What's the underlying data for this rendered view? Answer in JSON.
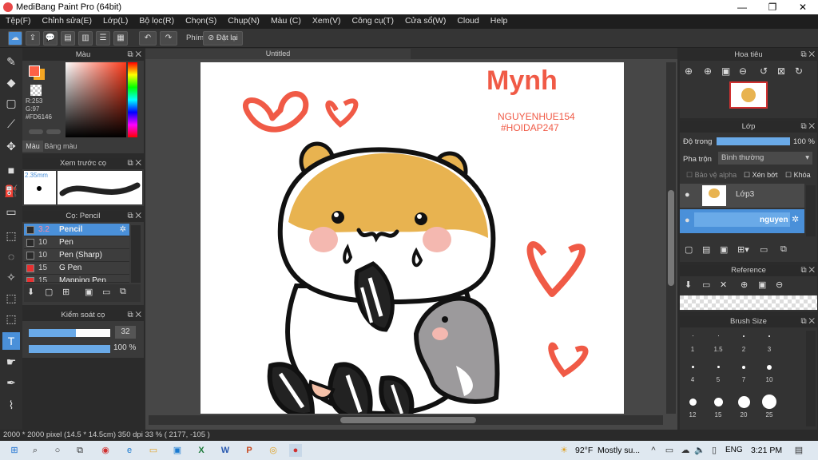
{
  "window": {
    "title": "MediBang Paint Pro (64bit)"
  },
  "menu": [
    "Tệp(F)",
    "Chỉnh sửa(E)",
    "Lớp(L)",
    "Bộ lọc(R)",
    "Chọn(S)",
    "Chụp(N)",
    "Màu (C)",
    "Xem(V)",
    "Công cụ(T)",
    "Cửa sổ(W)",
    "Cloud",
    "Help"
  ],
  "toolbar": {
    "shortcut_label": "Phím",
    "undo_label": "Đặt lại"
  },
  "color_panel": {
    "title": "Màu",
    "r": "R:253",
    "g": "G:97",
    "hex": "#FD6146",
    "tab_color": "Màu",
    "tab_palette": "Bảng màu",
    "primary": "#fd6146",
    "secondary": "#f5a623"
  },
  "brush_preview": {
    "title": "Xem trước cọ",
    "size": "2.35mm"
  },
  "brush_panel": {
    "title": "Cọ: Pencil",
    "items": [
      {
        "size": "3.2",
        "name": "Pencil",
        "color": "#2a2a2a"
      },
      {
        "size": "10",
        "name": "Pen",
        "color": "#2a2a2a"
      },
      {
        "size": "10",
        "name": "Pen (Sharp)",
        "color": "#2a2a2a"
      },
      {
        "size": "15",
        "name": "G Pen",
        "color": "#e83030"
      },
      {
        "size": "15",
        "name": "Mapping Pen",
        "color": "#e83030"
      }
    ]
  },
  "brush_control": {
    "title": "Kiểm soát cọ",
    "size": "32",
    "opacity": "100 %"
  },
  "canvas": {
    "tab_title": "Untitled",
    "text_name": "Mynh",
    "text_user": "NGUYENHUE154",
    "text_tag": "#HOIDAP247"
  },
  "navigator": {
    "title": "Hoa tiêu"
  },
  "layer_panel": {
    "title": "Lớp",
    "opacity_label": "Độ trong",
    "opacity_value": "100 %",
    "blend_label": "Pha trộn",
    "blend_value": "Bình thường",
    "protect_alpha": "Bảo vệ alpha",
    "clipping": "Xén bớt",
    "lock": "Khóa",
    "layers": [
      {
        "name": "Lớp3"
      },
      {
        "name": "nguyen"
      }
    ]
  },
  "reference": {
    "title": "Reference"
  },
  "brush_size": {
    "title": "Brush Size",
    "sizes": [
      "1",
      "1.5",
      "2",
      "3",
      "4",
      "5",
      "7",
      "10",
      "12",
      "15",
      "20",
      "25"
    ]
  },
  "status": {
    "text": "2000 * 2000 pixel   (14.5 * 14.5cm)   350 dpi   33 %   ( 2177, -105 )"
  },
  "taskbar": {
    "weather_temp": "92°F",
    "weather_desc": "Mostly su...",
    "lang": "ENG",
    "time": "3:21 PM"
  }
}
